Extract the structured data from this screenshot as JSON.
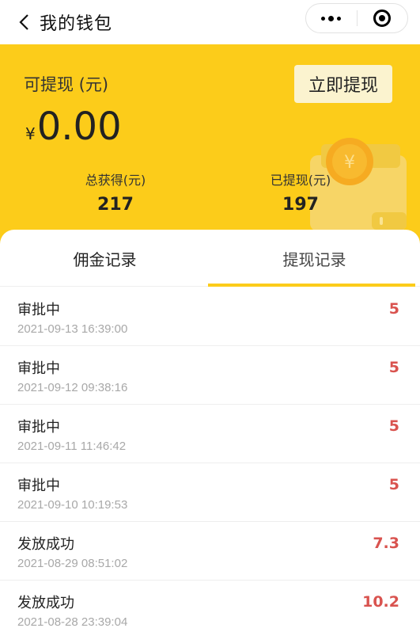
{
  "navbar": {
    "title": "我的钱包",
    "back_icon": "chevron-left-icon",
    "more_icon": "more-dots-icon",
    "close_icon": "target-close-icon"
  },
  "wallet": {
    "available_label": "可提现 (元)",
    "withdraw_button": "立即提现",
    "currency_symbol": "¥",
    "balance": "0.00",
    "total_earned_label": "总获得(元)",
    "total_earned": "217",
    "withdrawn_label": "已提现(元)",
    "withdrawn": "197",
    "illustration_icon": "wallet-coin-icon",
    "illustration_symbol": "¥"
  },
  "tabs": [
    {
      "label": "佣金记录",
      "active": false
    },
    {
      "label": "提现记录",
      "active": true
    }
  ],
  "records": [
    {
      "status": "审批中",
      "time": "2021-09-13 16:39:00",
      "amount": "5"
    },
    {
      "status": "审批中",
      "time": "2021-09-12 09:38:16",
      "amount": "5"
    },
    {
      "status": "审批中",
      "time": "2021-09-11 11:46:42",
      "amount": "5"
    },
    {
      "status": "审批中",
      "time": "2021-09-10 10:19:53",
      "amount": "5"
    },
    {
      "status": "发放成功",
      "time": "2021-08-29 08:51:02",
      "amount": "7.3"
    },
    {
      "status": "发放成功",
      "time": "2021-08-28 23:39:04",
      "amount": "10.2"
    }
  ],
  "colors": {
    "brand_yellow": "#fccc1a",
    "amount_red": "#d9534f"
  }
}
